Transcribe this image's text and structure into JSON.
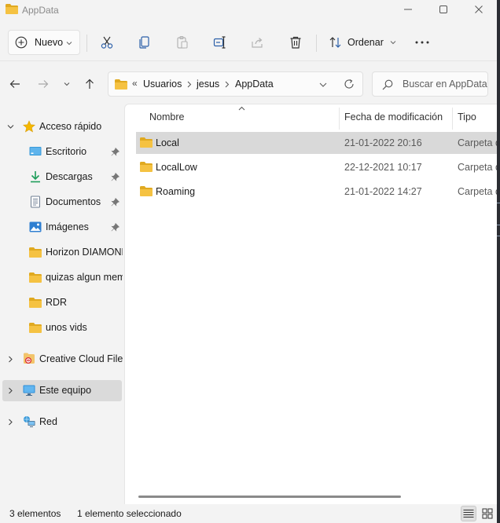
{
  "window": {
    "title": "AppData"
  },
  "toolbar": {
    "new_label": "Nuevo",
    "sort_label": "Ordenar"
  },
  "address": {
    "overflow": "«",
    "crumbs": [
      "Usuarios",
      "jesus",
      "AppData"
    ]
  },
  "search": {
    "placeholder": "Buscar en AppData"
  },
  "sidebar": {
    "items": [
      {
        "label": "Acceso rápido",
        "icon": "star-icon"
      },
      {
        "label": "Escritorio",
        "icon": "desktop-icon",
        "pinned": true
      },
      {
        "label": "Descargas",
        "icon": "download-icon",
        "pinned": true
      },
      {
        "label": "Documentos",
        "icon": "document-icon",
        "pinned": true
      },
      {
        "label": "Imágenes",
        "icon": "pictures-icon",
        "pinned": true
      },
      {
        "label": "Horizon DIAMOND",
        "icon": "folder-icon"
      },
      {
        "label": "quizas algun mem",
        "icon": "folder-icon"
      },
      {
        "label": "RDR",
        "icon": "folder-icon"
      },
      {
        "label": "unos vids",
        "icon": "folder-icon"
      },
      {
        "label": "Creative Cloud Files",
        "icon": "creative-cloud-icon"
      },
      {
        "label": "Este equipo",
        "icon": "computer-icon",
        "selected": true
      },
      {
        "label": "Red",
        "icon": "network-icon"
      }
    ]
  },
  "columns": {
    "name": "Nombre",
    "modified": "Fecha de modificación",
    "type": "Tipo"
  },
  "files": [
    {
      "name": "Local",
      "modified": "21-01-2022 20:16",
      "type": "Carpeta de archivos",
      "selected": true
    },
    {
      "name": "LocalLow",
      "modified": "22-12-2021 10:17",
      "type": "Carpeta de archivos"
    },
    {
      "name": "Roaming",
      "modified": "21-01-2022 14:27",
      "type": "Carpeta de archivos"
    }
  ],
  "status": {
    "count": "3 elementos",
    "selection": "1 elemento seleccionado"
  },
  "colors": {
    "folder": "#f5c242",
    "folder_dark": "#e0a920",
    "selection": "#d9d9d9",
    "accent": "#0067c0"
  }
}
